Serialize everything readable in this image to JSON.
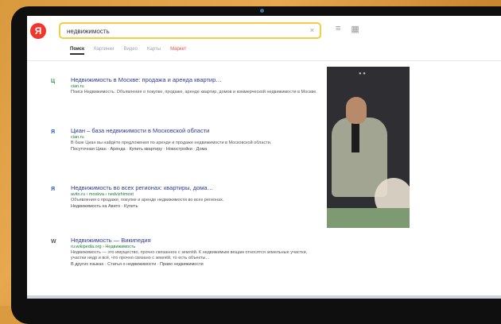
{
  "browser": {
    "logo_letter": "Я",
    "query": "недвижимость",
    "clear_symbol": "×",
    "tools": [
      "≡",
      "▦"
    ]
  },
  "tabs": [
    {
      "label": "Поиск",
      "active": true
    },
    {
      "label": "Картинки"
    },
    {
      "label": "Видео"
    },
    {
      "label": "Карты"
    },
    {
      "label": "Маркет",
      "market": true
    }
  ],
  "results": [
    {
      "favicon": "Ц",
      "favicon_color": "#2b9a4a",
      "title": "Недвижимость в Москве: продажа и аренда квартир…",
      "url": "cian.ru",
      "snippet": "Поиск Недвижимость. Объявления о покупке, продаже, аренде квартир, домов и коммерческой недвижимости в Москве.",
      "links": ""
    },
    {
      "favicon": "Я",
      "favicon_color": "#2b5cc4",
      "title": "Циан – база недвижимости в Московской области",
      "url": "cian.ru",
      "snippet": "В базе Циан вы найдёте предложения по аренде и продаже недвижимости в Московской области.",
      "links": "Посуточная Циан · Аренда · Купить квартиру · Новостройки · Дома"
    },
    {
      "favicon": "Я",
      "favicon_color": "#2b5cc4",
      "title": "Недвижимость во всех регионах: квартиры, дома…",
      "url": "avito.ru › moskva › nedvizhimost",
      "snippet": "Объявления о продаже, покупке и аренде недвижимости во всех регионах.",
      "links": "Недвижимость на Авито · Купить"
    },
    {
      "favicon": "W",
      "favicon_color": "#555555",
      "title": "Недвижимость — Википедия",
      "url": "ru.wikipedia.org › Недвижимость",
      "snippet": "Недвижимость — это имущество, прочно связанное с землёй. К недвижимым вещам относятся земельные участки, участки недр и всё, что прочно связано с землёй, то есть объекты…",
      "links": "В других языках · Статья о недвижимости · Право недвижимости"
    }
  ]
}
